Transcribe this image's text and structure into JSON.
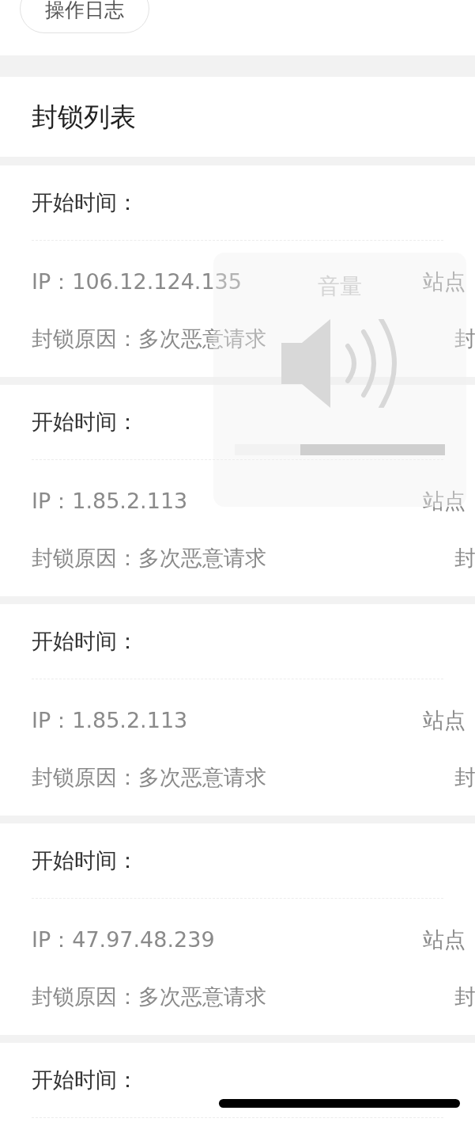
{
  "top_button": {
    "label": "操作日志"
  },
  "section": {
    "title": "封锁列表"
  },
  "records": [
    {
      "start_label": "开始时间：",
      "ip": "IP：106.12.124.135",
      "site": "站点",
      "reason": "封锁原因：多次恶意请求",
      "column_4": "封"
    },
    {
      "start_label": "开始时间：",
      "ip": "IP：1.85.2.113",
      "site": "站点",
      "reason": "封锁原因：多次恶意请求",
      "column_4": "封"
    },
    {
      "start_label": "开始时间：",
      "ip": "IP：1.85.2.113",
      "site": "站点",
      "reason": "封锁原因：多次恶意请求",
      "column_4": "封"
    },
    {
      "start_label": "开始时间：",
      "ip": "IP：47.97.48.239",
      "site": "站点",
      "reason": "封锁原因：多次恶意请求",
      "column_4": "封"
    },
    {
      "start_label": "开始时间："
    }
  ],
  "volume_hud": {
    "title": "音量",
    "level": 0.31
  }
}
